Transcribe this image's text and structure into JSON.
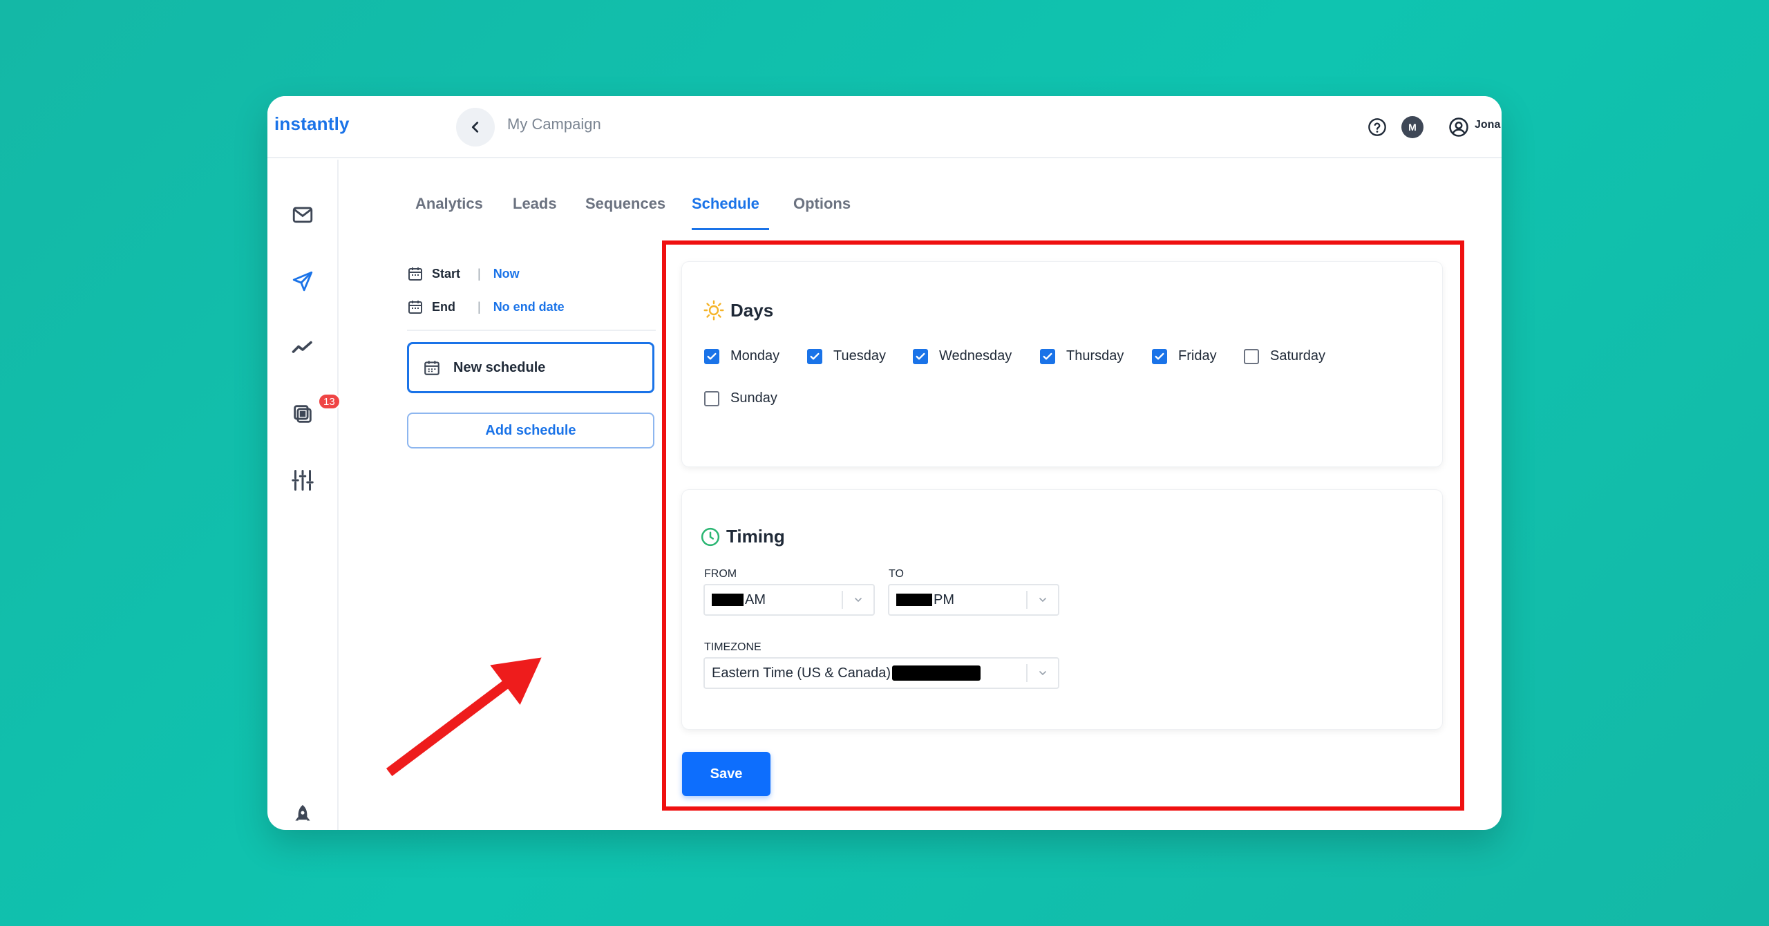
{
  "app": {
    "logo": "instantly",
    "breadcrumb": "My Campaign",
    "user_initial": "M",
    "user_name": "Jona"
  },
  "sidebar": {
    "items": [
      {
        "icon": "mail-icon"
      },
      {
        "icon": "send-icon"
      },
      {
        "icon": "analytics-icon"
      },
      {
        "icon": "copy-icon",
        "badge": "13"
      },
      {
        "icon": "sliders-icon"
      },
      {
        "icon": "rocket-icon"
      }
    ]
  },
  "tabs": [
    {
      "label": "Analytics",
      "active": false
    },
    {
      "label": "Leads",
      "active": false
    },
    {
      "label": "Sequences",
      "active": false
    },
    {
      "label": "Schedule",
      "active": true
    },
    {
      "label": "Options",
      "active": false
    }
  ],
  "schedule_panel": {
    "start_label": "Start",
    "start_value": "Now",
    "end_label": "End",
    "end_value": "No end date",
    "schedule_item": "New schedule",
    "add_button": "Add schedule"
  },
  "days": {
    "title": "Days",
    "items": [
      {
        "label": "Monday",
        "checked": true
      },
      {
        "label": "Tuesday",
        "checked": true
      },
      {
        "label": "Wednesday",
        "checked": true
      },
      {
        "label": "Thursday",
        "checked": true
      },
      {
        "label": "Friday",
        "checked": true
      },
      {
        "label": "Saturday",
        "checked": false
      },
      {
        "label": "Sunday",
        "checked": false
      }
    ]
  },
  "timing": {
    "title": "Timing",
    "from_label": "FROM",
    "from_suffix": "AM",
    "to_label": "TO",
    "to_suffix": "PM",
    "timezone_label": "TIMEZONE",
    "timezone_value": "Eastern Time (US & Canada)"
  },
  "save_button": "Save",
  "colors": {
    "accent": "#1a73e8",
    "background": "#12bfae",
    "highlight": "#ef1010"
  }
}
